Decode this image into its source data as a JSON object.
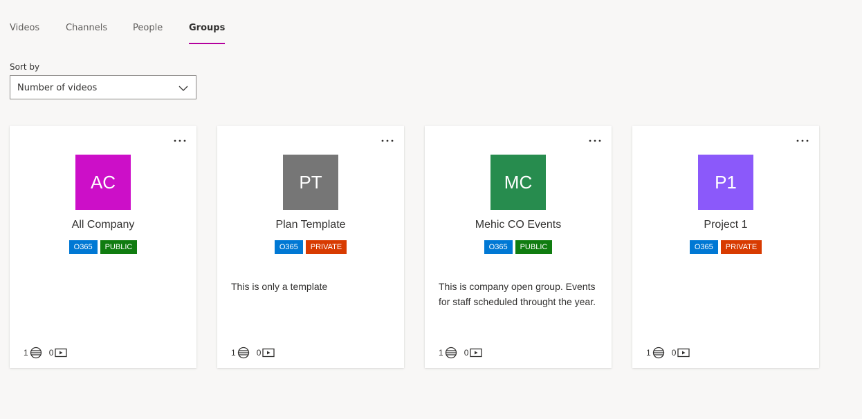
{
  "tabs": [
    {
      "label": "Videos"
    },
    {
      "label": "Channels"
    },
    {
      "label": "People"
    },
    {
      "label": "Groups"
    }
  ],
  "active_tab": "Groups",
  "sort": {
    "label": "Sort by",
    "value": "Number of videos"
  },
  "colors": {
    "accent": "#b4009e",
    "o365": "#0078d4",
    "public": "#107c10",
    "private": "#d83b01"
  },
  "cards": [
    {
      "initials": "AC",
      "color": "#cc0fc8",
      "name": "All Company",
      "badge1": "O365",
      "badge2": "PUBLIC",
      "description": "",
      "members": "1",
      "videos": "0"
    },
    {
      "initials": "PT",
      "color": "#767676",
      "name": "Plan Template",
      "badge1": "O365",
      "badge2": "PRIVATE",
      "description": "This is only a template",
      "members": "1",
      "videos": "0"
    },
    {
      "initials": "MC",
      "color": "#278c4e",
      "name": "Mehic CO Events",
      "badge1": "O365",
      "badge2": "PUBLIC",
      "description": "This is company open group. Events for staff scheduled throught the year.",
      "members": "1",
      "videos": "0"
    },
    {
      "initials": "P1",
      "color": "#8b59fa",
      "name": "Project 1",
      "badge1": "O365",
      "badge2": "PRIVATE",
      "description": "",
      "members": "1",
      "videos": "0"
    }
  ]
}
